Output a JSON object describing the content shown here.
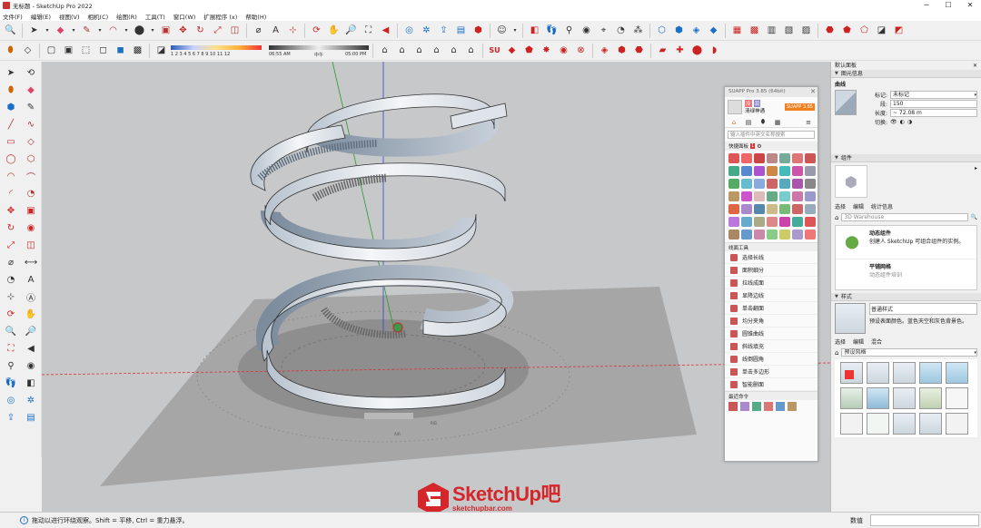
{
  "window": {
    "title": "无标题 - SketchUp Pro 2022"
  },
  "menu": [
    "文件(F)",
    "编辑(E)",
    "视图(V)",
    "相机(C)",
    "绘图(R)",
    "工具(T)",
    "窗口(W)",
    "扩展程序 (x)",
    "帮助(H)"
  ],
  "shadow_bar": {
    "months": "1 2 3 4 5 6 7 8 9 10 11 12",
    "time_start": "06:55 AM",
    "time_mid": "中午",
    "time_end": "05:00 PM"
  },
  "suapp": {
    "title": "SUAPP Pro 3.85 (64bit)",
    "user_line1": "冷",
    "user_line2": "润",
    "user_name": "清绿神通",
    "upgrade": "SUAPP 3.85",
    "search_placeholder": "输入插件中英文名称搜索",
    "quick_panel": "快捷面板",
    "quick_badge": "1",
    "section_line_tools": "线面工具",
    "line_tools": [
      "选择长线",
      "面积细分",
      "拉线成面",
      "显降边线",
      "单击翻面",
      "均分夹角",
      "圆锥曲线",
      "斜线填充",
      "线倒圆角",
      "单击多边形",
      "智能删面"
    ],
    "section_recent": "最近命令"
  },
  "tray": {
    "title": "默认面板",
    "entity_info": {
      "header": "图元信息",
      "type": "曲线",
      "tag_label": "标记:",
      "tag_value": "未标记",
      "segments_label": "段:",
      "segments_value": "150",
      "length_label": "长度:",
      "length_value": "~ 72.08 m",
      "toggle_label": "切换:"
    },
    "components": {
      "header": "组件",
      "tabs": [
        "选择",
        "编辑",
        "统计信息"
      ],
      "search_placeholder": "3D Warehouse",
      "item1_title": "动态组件",
      "item1_desc": "创建人 SketchUp 可组合组件的实例。",
      "item2_title": "平铺网格",
      "item2_desc": "动态组件培训"
    },
    "styles": {
      "header": "样式",
      "style_name": "普通样式",
      "style_desc": "预设表面颜色。蓝色天空和灰色背景色。",
      "tabs": [
        "选择",
        "编辑",
        "混合"
      ],
      "dropdown": "预设风格"
    }
  },
  "status": {
    "message": "拖动以进行环绕观察。Shift = 平移,  Ctrl = 重力悬浮。",
    "value_label": "数值"
  },
  "watermark": {
    "brand": "SketchUp吧",
    "url": "sketchupbar.com"
  },
  "scene": {
    "dim_label_a": "A/R",
    "dim_label_b": "R/B"
  }
}
